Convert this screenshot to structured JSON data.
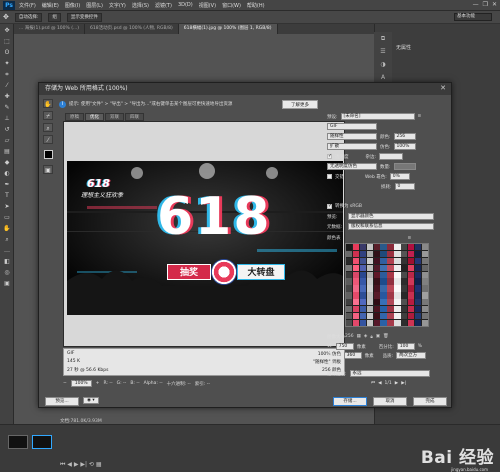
{
  "app": {
    "logo": "Ps",
    "menu": [
      "文件(F)",
      "编辑(E)",
      "图像(I)",
      "图层(L)",
      "文字(Y)",
      "选择(S)",
      "滤镜(T)",
      "3D(D)",
      "视图(V)",
      "窗口(W)",
      "帮助(H)"
    ],
    "window_controls": [
      "—",
      "❐",
      "✕"
    ],
    "options": [
      "自动选择:",
      "组",
      "显示变换控件"
    ],
    "workspace": "基本功能",
    "doc_tabs": [
      "... 海报(1).psd @ 100% (...)",
      "618活动页.psd @ 100% (人物, RGB/8)",
      "618横幅(1).jpg @ 100% (图层 1, RGB/8)"
    ],
    "right_panel_label": "无属性",
    "status": "文档:781.0K/3.93M",
    "watermark": "Bai 经验",
    "watermark_sub": "jingyan.baidu.com"
  },
  "dialog": {
    "title": "存储为 Web 所用格式 (100%)",
    "close": "✕",
    "hint": "提示: 使用\"文件\" > \"导出\" > \"导出为...\"或右键单击某个图层可更快速地导出资源",
    "learn_more": "了解更多",
    "view_tabs": [
      "原稿",
      "优化",
      "双联",
      "四联"
    ],
    "banner": {
      "badge_number": "618",
      "badge_text": "理想主义狂欢季",
      "big_number": "618",
      "left_label": "抽奖",
      "right_label": "大转盘"
    },
    "preview_info": {
      "format": "GIF",
      "size": "145 K",
      "time": "27 秒 @ 56.6 Kbps",
      "quality": "100% 仿色",
      "palette": "\"随样性\" 调板",
      "colors": "256 颜色"
    },
    "bottom": {
      "zoom": "100%",
      "r": "R: --",
      "g": "G: --",
      "b": "B: --",
      "alpha": "Alpha: --",
      "hex": "十六进制: --",
      "index": "索引: --"
    },
    "settings": {
      "preset_label": "预设:",
      "preset_value": "[未命名]",
      "format": "GIF",
      "reduction": "随样性",
      "colors_label": "颜色:",
      "colors_value": "256",
      "dither_algo": "扩散",
      "dither_label": "仿色:",
      "dither_value": "100%",
      "transparency_label": "透明度",
      "matte_label": "杂边:",
      "trans_dither": "无透明度仿色",
      "amount_label": "数量:",
      "interlaced_label": "交错",
      "web_snap_label": "Web 靠色:",
      "web_snap_value": "0%",
      "lossy_label": "损耗:",
      "lossy_value": "0",
      "srgb_label": "转换为 sRGB",
      "preview_label": "预览:",
      "preview_value": "显示器颜色",
      "metadata_label": "元数据:",
      "metadata_value": "版权和联系信息",
      "color_table_label": "颜色表",
      "color_count": "256"
    },
    "image_size": {
      "title": "图像大小",
      "w_label": "W:",
      "w_value": "750",
      "h_label": "H:",
      "h_value": "360",
      "unit": "像素",
      "percent_label": "百分比:",
      "percent_value": "100",
      "percent_unit": "%",
      "quality_label": "品质:",
      "quality_value": "两次立方",
      "anim_title": "动画",
      "loop_label": "循环选项:",
      "loop_value": "永远",
      "frame": "1/1"
    },
    "buttons": {
      "preview": "预览...",
      "save": "存储...",
      "cancel": "取消",
      "done": "完成"
    }
  },
  "colors": {
    "accent": "#31a8ff",
    "swatches": [
      "#1a1a1a",
      "#e83a5a",
      "#3a3a6a",
      "#c4c4c4",
      "#5a1f2a",
      "#2a5a8a",
      "#8a2a3a",
      "#f0f0f0",
      "#444",
      "#b01040",
      "#203060",
      "#888",
      "#6a6a6a",
      "#d03050",
      "#304080",
      "#aaa",
      "#301018",
      "#1f4a7a",
      "#9a3040",
      "#e0e0e0",
      "#555",
      "#c02050",
      "#102040",
      "#999",
      "#2a2a2a",
      "#f05070",
      "#405090",
      "#ccc",
      "#401020",
      "#3060a0",
      "#b04050",
      "#ddd",
      "#333",
      "#a01030",
      "#253575",
      "#777",
      "#7a7a7a",
      "#ff6080",
      "#5060b0",
      "#bbb",
      "#501828",
      "#4070b0",
      "#c05060",
      "#eee",
      "#222",
      "#e04060",
      "#152555",
      "#666",
      "#3a3a3a",
      "#d84868",
      "#2a4890",
      "#b0b0b0",
      "#601828",
      "#2c5c9c",
      "#a83848",
      "#f8f8f8",
      "#4a4a4a",
      "#b82848",
      "#1a2a60",
      "#909090",
      "#5c5c5c",
      "#ee5878",
      "#3858a8",
      "#c8c8c8",
      "#381018",
      "#1c4c8c",
      "#903040",
      "#e8e8e8",
      "#2c2c2c",
      "#d03858",
      "#10204c",
      "#808080",
      "#464646",
      "#f26888",
      "#4868b8",
      "#d0d0d0",
      "#481420",
      "#3868a8",
      "#b84858",
      "#fafafa",
      "#383838",
      "#a81838",
      "#1e3070",
      "#707070",
      "#626262",
      "#e44a6a",
      "#2e4e98",
      "#bcbcbc",
      "#581a28",
      "#2858a0",
      "#a03848",
      "#e4e4e4",
      "#282828",
      "#c83050",
      "#162a5a",
      "#a0a0a0",
      "#404040",
      "#fa7090",
      "#5068c0",
      "#c0c0c0",
      "#300c14",
      "#3870b8",
      "#b04858",
      "#f4f4f4",
      "#505050",
      "#b81c40",
      "#203468",
      "#787878",
      "#6e6e6e",
      "#dc4264",
      "#3c5ca8",
      "#b4b4b4",
      "#4c1420",
      "#2660a8",
      "#9c3444",
      "#ececec",
      "#343434",
      "#c42a4c",
      "#18285c",
      "#8c8c8c",
      "#585858",
      "#f46282",
      "#4464b0",
      "#cacaca",
      "#3c1018",
      "#3266ac",
      "#aa4252",
      "#f0f0f0",
      "#3e3e3e",
      "#ae1c3c",
      "#223a70",
      "#747474",
      "#4c4c4c",
      "#e2486a",
      "#3454a0",
      "#c4c4c4",
      "#56182a",
      "#2a62a6",
      "#a43a4a",
      "#dedede",
      "#2e2e2e",
      "#ce3454",
      "#142658",
      "#969696"
    ]
  }
}
